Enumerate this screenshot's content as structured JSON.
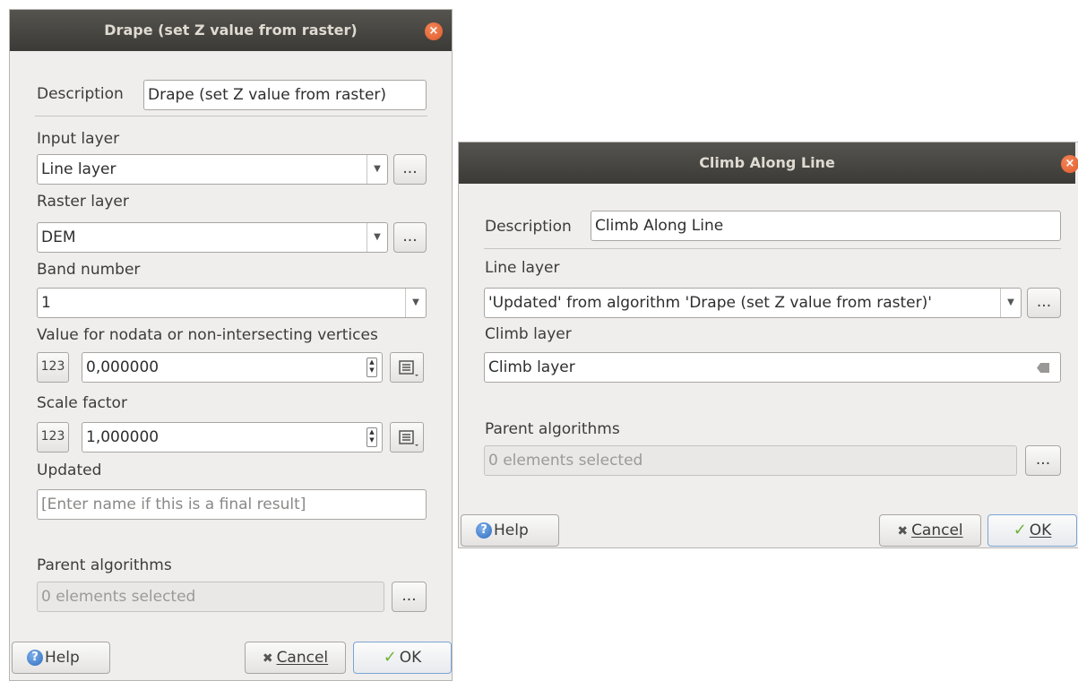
{
  "drape": {
    "title": "Drape (set Z value from raster)",
    "description_label": "Description",
    "description_value": "Drape (set Z value from raster)",
    "input_layer_label": "Input layer",
    "input_layer_value": "Line layer",
    "raster_layer_label": "Raster layer",
    "raster_layer_value": "DEM",
    "band_number_label": "Band number",
    "band_number_value": "1",
    "nodata_label": "Value for nodata or non-intersecting vertices",
    "nodata_value": "0,000000",
    "scale_factor_label": "Scale factor",
    "scale_factor_value": "1,000000",
    "updated_label": "Updated",
    "updated_placeholder": "[Enter name if this is a final result]",
    "parent_algorithms_label": "Parent algorithms",
    "parent_algorithms_value": "0 elements selected",
    "help_label": "Help",
    "cancel_label": "Cancel",
    "ok_label": "OK"
  },
  "climb": {
    "title": "Climb Along Line",
    "description_label": "Description",
    "description_value": "Climb Along Line",
    "line_layer_label": "Line layer",
    "line_layer_value": "'Updated' from algorithm 'Drape (set Z value from raster)'",
    "climb_layer_label": "Climb layer",
    "climb_layer_value": "Climb layer",
    "parent_algorithms_label": "Parent algorithms",
    "parent_algorithms_value": "0 elements selected",
    "help_label": "Help",
    "cancel_label": "Cancel",
    "ok_label": "OK"
  },
  "common": {
    "ellipsis": "...",
    "numeric_icon_text": "123"
  }
}
